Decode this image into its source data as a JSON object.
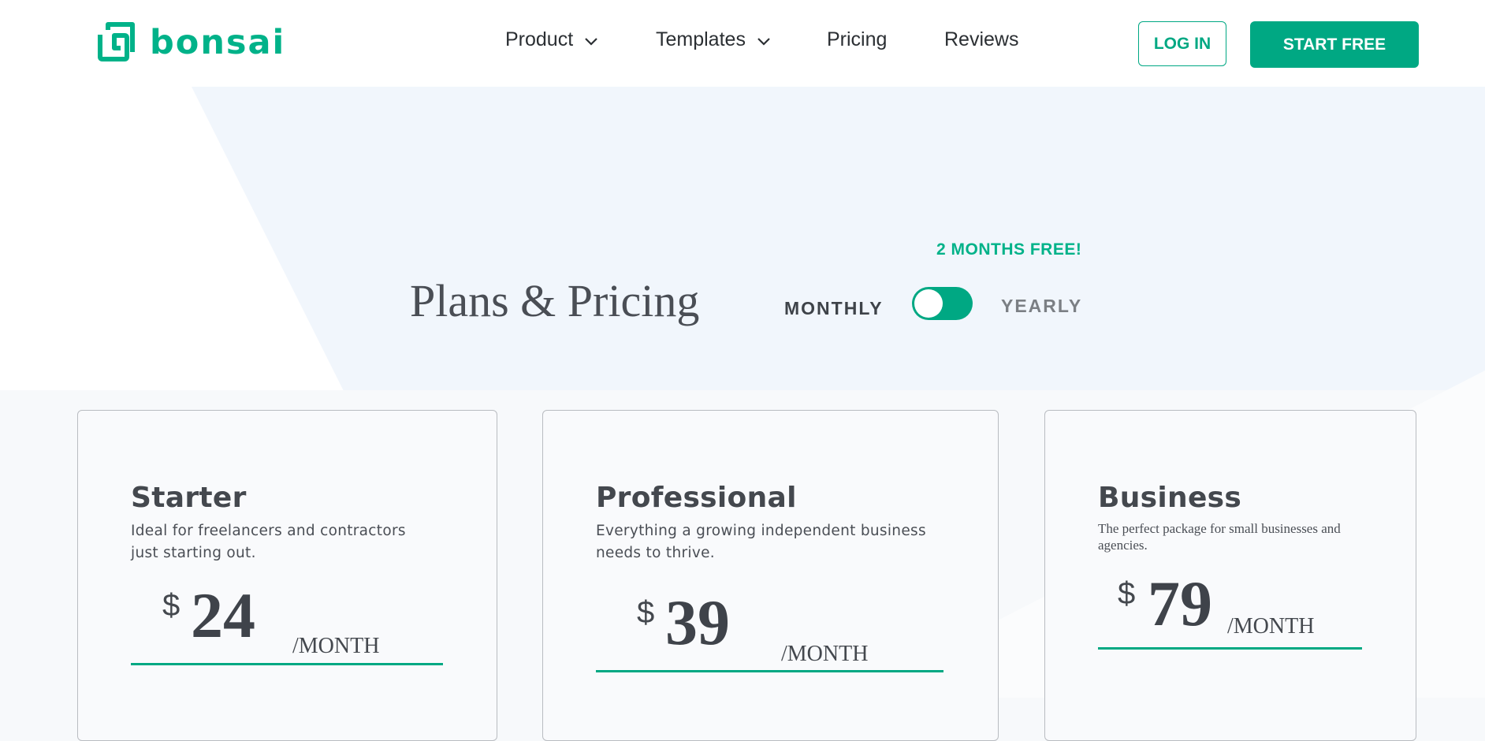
{
  "brand": {
    "name": "bonsai",
    "accent_color": "#00b289",
    "button_color": "#00a883"
  },
  "nav": {
    "items": [
      {
        "label": "Product",
        "has_dropdown": true
      },
      {
        "label": "Templates",
        "has_dropdown": true
      },
      {
        "label": "Pricing",
        "has_dropdown": false
      },
      {
        "label": "Reviews",
        "has_dropdown": false
      }
    ],
    "login_label": "LOG IN",
    "start_label": "START FREE"
  },
  "hero": {
    "title": "Plans & Pricing",
    "promo": "2 MONTHS FREE!",
    "billing_toggle": {
      "monthly_label": "MONTHLY",
      "yearly_label": "YEARLY",
      "selected": "monthly"
    }
  },
  "plans": [
    {
      "name": "Starter",
      "description": "Ideal for freelancers and contractors just starting out.",
      "currency": "$",
      "price": "24",
      "period": "/MONTH"
    },
    {
      "name": "Professional",
      "description": "Everything a growing independent business needs to thrive.",
      "currency": "$",
      "price": "39",
      "period": "/MONTH"
    },
    {
      "name": "Business",
      "description": "The perfect package for small businesses and agencies.",
      "currency": "$",
      "price": "79",
      "period": "/MONTH"
    }
  ]
}
